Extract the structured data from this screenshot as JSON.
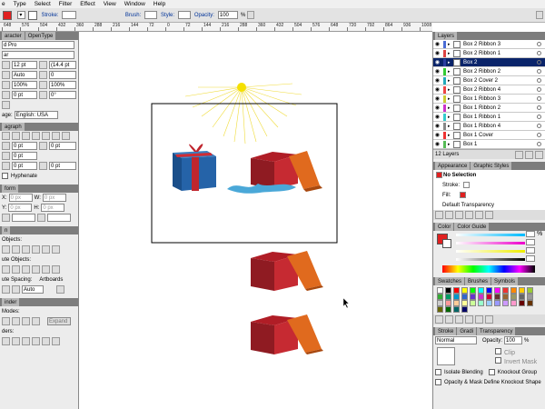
{
  "menu": [
    "e",
    "Type",
    "Select",
    "Filter",
    "Effect",
    "View",
    "Window",
    "Help"
  ],
  "control": {
    "stroke_label": "Stroke:",
    "brush_label": "Brush:",
    "style_label": "Style:",
    "opacity_label": "Opacity:",
    "opacity_value": "100",
    "pct": "%"
  },
  "ruler": [
    "648",
    "576",
    "504",
    "432",
    "360",
    "288",
    "216",
    "144",
    "72",
    "0",
    "72",
    "144",
    "216",
    "288",
    "360",
    "432",
    "504",
    "576",
    "648",
    "720",
    "792",
    "864",
    "936",
    "1008"
  ],
  "left": {
    "character_tab": "aracter",
    "opentype_tab": "OpenType",
    "font": "d Pro",
    "style": "ar",
    "size": "12 pt",
    "leading": "(14.4 pt",
    "kerning": "Auto",
    "tracking": "0",
    "hscale": "100%",
    "vscale": "100%",
    "baseline": "0 pt",
    "rotate": "0°",
    "language_label": "age:",
    "language": "English: USA",
    "paragraph_tab": "agraph",
    "indent1": "0 pt",
    "indent2": "0 pt",
    "indent3": "0 pt",
    "indent4": "0 pt",
    "indent5": "0 pt",
    "hyphenate": "Hyphenate",
    "transform_tab": "form",
    "x_label": "X:",
    "y_label": "Y:",
    "w_label": "W:",
    "h_label": "H:",
    "x": "0 px",
    "y": "0 px",
    "w": "0 px",
    "h": "0 px",
    "align_tab": "n",
    "align_objects": "Objects:",
    "distribute_objects": "ute Objects:",
    "distribute_spacing": "ute Spacing:",
    "align_to": "Artboards",
    "spacing_value": "Auto",
    "pathfinder_tab": "inder",
    "shape_modes": "Modes:",
    "pathfinders": "ders:",
    "expand": "Expand"
  },
  "layers": {
    "title": "Layers",
    "items": [
      {
        "name": "Box 2 Ribbon 3",
        "color": "#4a6cd4"
      },
      {
        "name": "Box 2 Ribbon 1",
        "color": "#d44"
      },
      {
        "name": "Box 2",
        "color": "#2a3ea0",
        "selected": true
      },
      {
        "name": "Box 2 Ribbon 2",
        "color": "#3c3"
      },
      {
        "name": "Box 2 Cover 2",
        "color": "#2ab"
      },
      {
        "name": "Box 2 Ribbon 4",
        "color": "#e44"
      },
      {
        "name": "Box 1 Ribbon 3",
        "color": "#cc3"
      },
      {
        "name": "Box 1 Ribbon 2",
        "color": "#c3c"
      },
      {
        "name": "Box 1 Ribbon 1",
        "color": "#3cc"
      },
      {
        "name": "Box 1 Ribbon 4",
        "color": "#888"
      },
      {
        "name": "Box 1 Cover",
        "color": "#e33"
      },
      {
        "name": "Box 1",
        "color": "#5b5"
      }
    ],
    "count": "12 Layers"
  },
  "appearance": {
    "tab1": "Appearance",
    "tab2": "Graphic Styles",
    "no_selection": "No Selection",
    "stroke": "Stroke:",
    "fill": "Fill:",
    "default_transparency": "Default Transparency"
  },
  "color": {
    "tab1": "Color",
    "tab2": "Color Guide",
    "pct": "%"
  },
  "swatches": {
    "tab1": "Swatches",
    "tab2": "Brushes",
    "tab3": "Symbols"
  },
  "transparency": {
    "tab1": "Stroke",
    "tab1b": "Gradi",
    "tab2": "Transparency",
    "mode": "Normal",
    "opacity_label": "Opacity:",
    "opacity": "100",
    "pct": "%",
    "clip": "Clip",
    "invert": "Invert Mask",
    "isolate": "Isolate Blending",
    "knockout": "Knockout Group",
    "opacity_mask": "Opacity & Mask Define Knockout Shape"
  },
  "colors": {
    "accent": "#0a246a",
    "box_red": "#c0262e",
    "box_blue": "#1f5fa0",
    "lid_orange": "#e06a1e",
    "ribbon_blue": "#4aa8d8",
    "sun": "#f5e000"
  }
}
